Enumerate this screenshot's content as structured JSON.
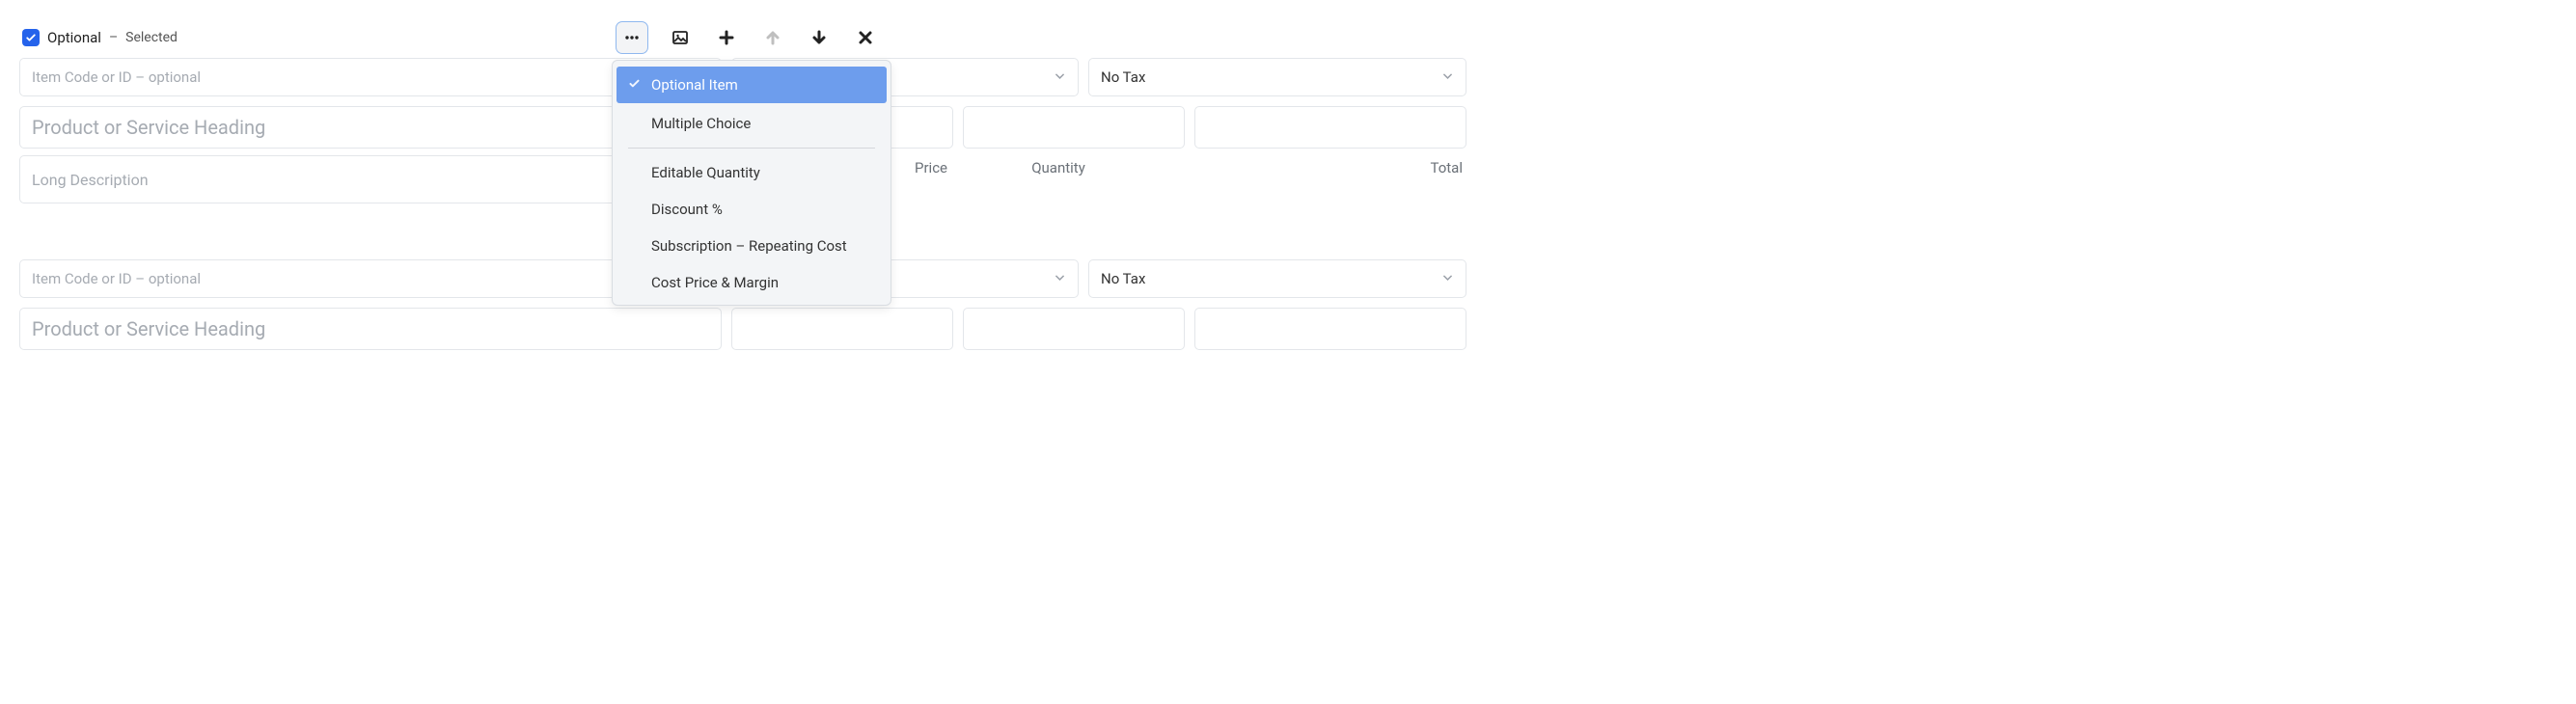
{
  "optional": {
    "checkbox_checked": true,
    "label": "Optional",
    "separator": "–",
    "selected_label": "Selected"
  },
  "menu": {
    "items": [
      {
        "label": "Optional Item",
        "checked": true
      },
      {
        "label": "Multiple Choice",
        "checked": false
      },
      {
        "label": "Editable Quantity",
        "checked": false
      },
      {
        "label": "Discount %",
        "checked": false
      },
      {
        "label": "Subscription – Repeating Cost",
        "checked": false
      },
      {
        "label": "Cost Price & Margin",
        "checked": false
      }
    ]
  },
  "placeholders": {
    "item_code": "Item Code or ID – optional",
    "heading": "Product or Service Heading",
    "long_desc": "Long Description"
  },
  "tax": {
    "value": "No Tax"
  },
  "labels": {
    "price": "Price",
    "quantity": "Quantity",
    "total": "Total"
  },
  "line_items": [
    {
      "item_code": "",
      "heading": "",
      "long_desc": "",
      "tax": "No Tax"
    },
    {
      "item_code": "",
      "heading": "",
      "long_desc": "",
      "tax": "No Tax"
    }
  ]
}
